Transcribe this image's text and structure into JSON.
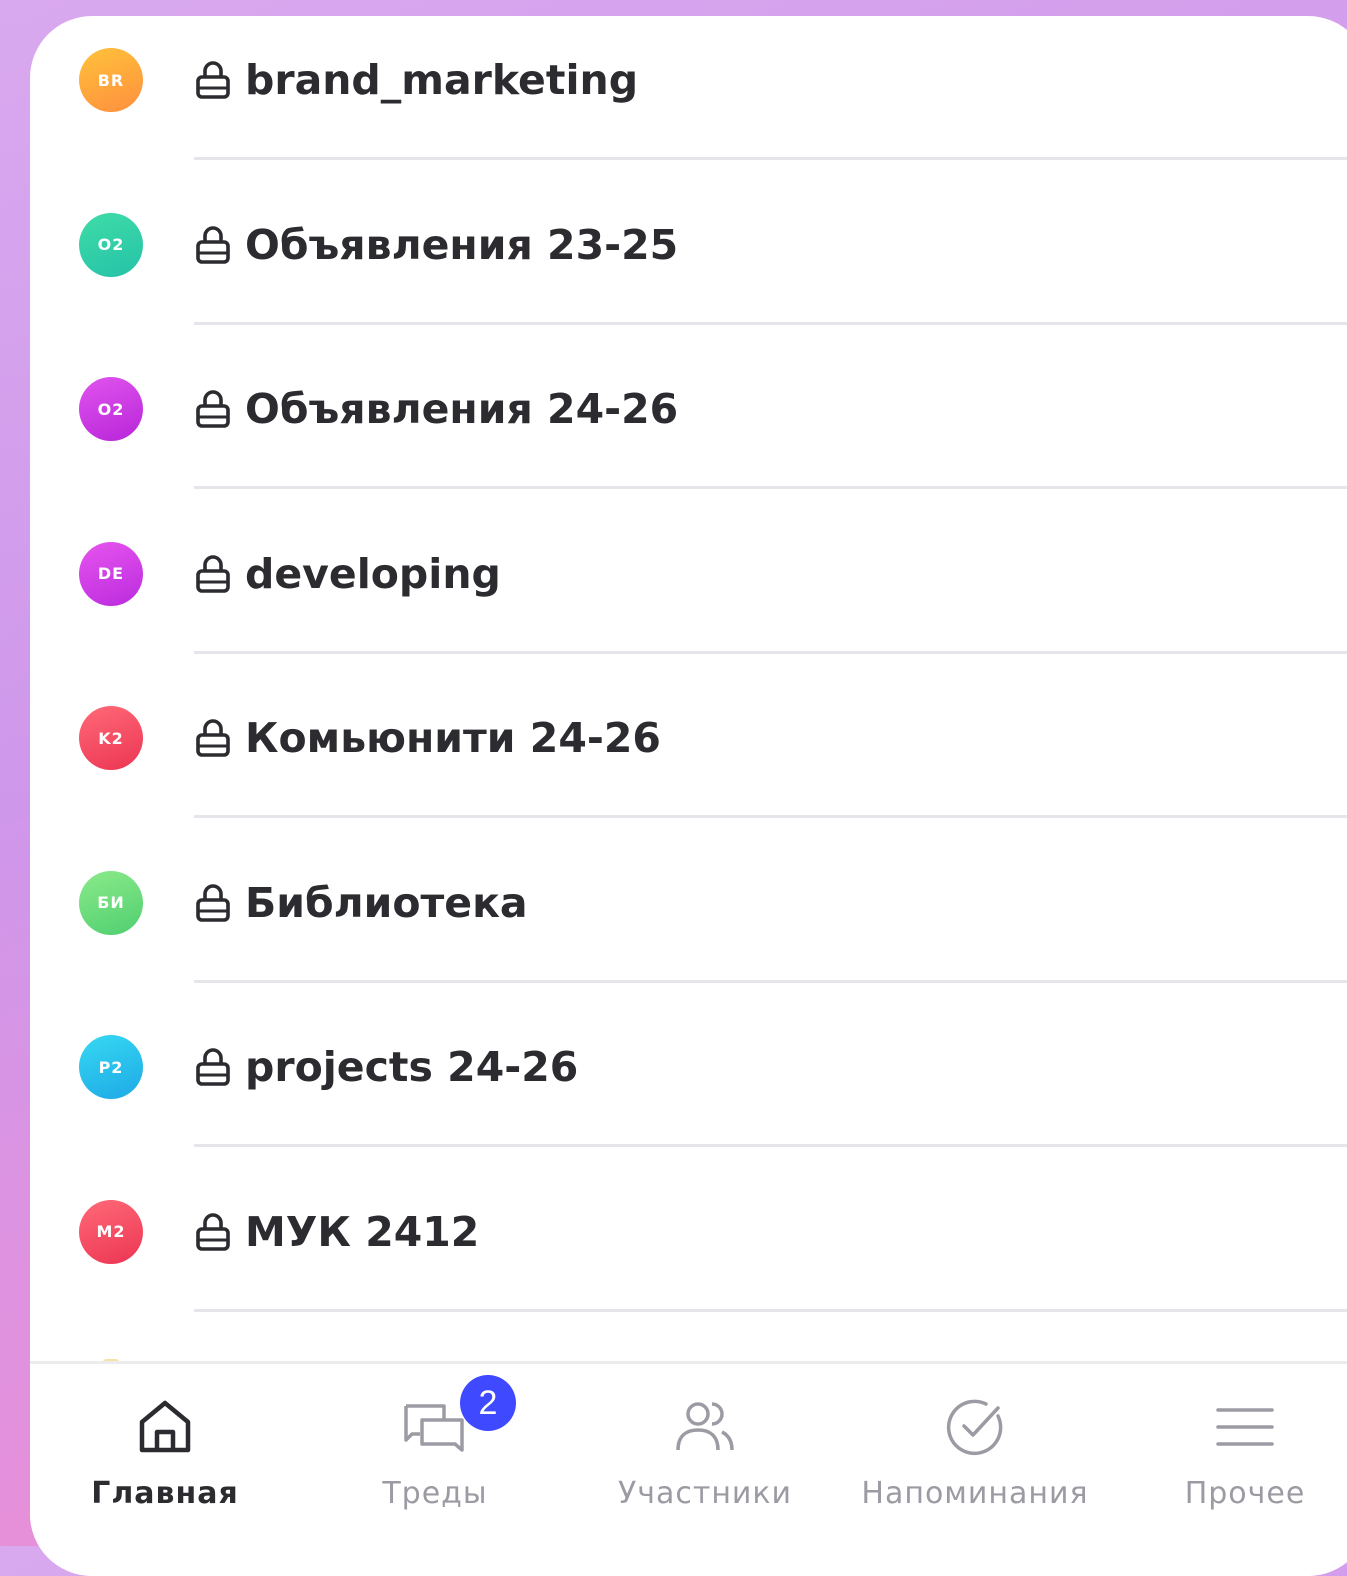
{
  "channels": [
    {
      "initials": "BR",
      "name": "brand_marketing",
      "colors": [
        "#ffc23a",
        "#ff8f3f"
      ]
    },
    {
      "initials": "O2",
      "name": "Объявления 23-25",
      "colors": [
        "#3fdca7",
        "#25c2a8"
      ]
    },
    {
      "initials": "O2",
      "name": "Объявления 24-26",
      "colors": [
        "#e055ee",
        "#b825d8"
      ]
    },
    {
      "initials": "DE",
      "name": "developing",
      "colors": [
        "#e655ee",
        "#bb2bde"
      ]
    },
    {
      "initials": "K2",
      "name": "Комьюнити 24-26",
      "colors": [
        "#ff6a77",
        "#ec3553"
      ]
    },
    {
      "initials": "БИ",
      "name": "Библиотека",
      "colors": [
        "#8cea8a",
        "#4fcf70"
      ]
    },
    {
      "initials": "P2",
      "name": "projects 24-26",
      "colors": [
        "#36d9f2",
        "#1ea9e6"
      ]
    },
    {
      "initials": "M2",
      "name": "МУК 2412",
      "colors": [
        "#ff6a77",
        "#ec3553"
      ]
    }
  ],
  "tabbar": {
    "home": "Главная",
    "threads": "Треды",
    "threads_badge": "2",
    "members": "Участники",
    "reminders": "Напоминания",
    "more": "Прочее"
  },
  "colors": {
    "active": "#2b2b30",
    "inactive": "#9b9ba3",
    "badge": "#3f49ff"
  }
}
